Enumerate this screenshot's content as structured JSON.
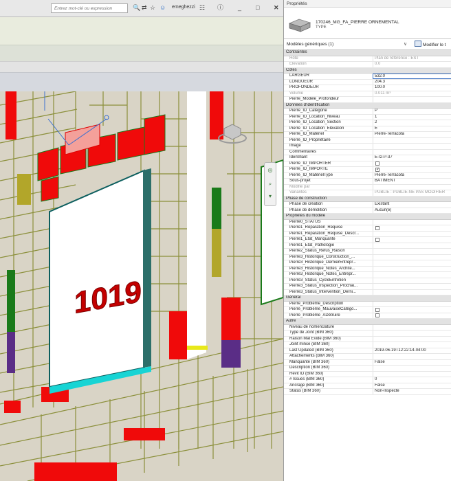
{
  "toolbar": {
    "search_placeholder": "Entrez mot-clé ou expression",
    "user": "emeghezzi",
    "icons": [
      "binoculars-icon",
      "star-icon",
      "user-icon",
      "cart-icon",
      "help-icon",
      "minimize-icon",
      "restore-icon",
      "close-icon"
    ]
  },
  "viewport": {
    "room_number": "1019",
    "colors": {
      "red": "#f00a0a",
      "stone": "#d9d4c6",
      "dark_green": "#1a7a1a",
      "purple": "#5a2d86",
      "yellow": "#e8e81a",
      "cyan": "#17d4d4",
      "olive": "#b2a62a",
      "teal": "#2c6f6a"
    }
  },
  "panel": {
    "title": "Propriétés",
    "type_name": "170246_MG_FA_PIERRE ORNEMENTAL",
    "type_sub": "TYPE",
    "instance_selector": "Modèles génériques (1)",
    "edit_type_label": "Modifier le t",
    "rows": [
      {
        "kind": "group",
        "label": "Contraintes"
      },
      {
        "label": "Hôte",
        "value": "Plan de référence : EST",
        "disabled": true
      },
      {
        "label": "Élévation",
        "value": "0.0",
        "disabled": true
      },
      {
        "kind": "group",
        "label": "Cotes"
      },
      {
        "label": "LARGEUR",
        "value": "532.0",
        "editing": true
      },
      {
        "label": "LONGUEUR",
        "value": "204.3"
      },
      {
        "label": "PROFONDEUR",
        "value": "100.0"
      },
      {
        "label": "Volume",
        "value": "0.011 m³",
        "disabled": true
      },
      {
        "label": "Pierre_Modele_Profondeur",
        "value": ""
      },
      {
        "kind": "group",
        "label": "Données d'identification"
      },
      {
        "label": "Pierre_ID_Catégorie",
        "value": "P"
      },
      {
        "label": "Pierre_ID_Location_Niveau",
        "value": "1"
      },
      {
        "label": "Pierre_ID_Location_Section",
        "value": "2"
      },
      {
        "label": "Pierre_ID_Location_Élévation",
        "value": "E"
      },
      {
        "label": "Pierre_ID_Matériel",
        "value": "Pierre-Terracota"
      },
      {
        "label": "Pierre_ID_Propriétaire",
        "value": ""
      },
      {
        "label": "Image",
        "value": ""
      },
      {
        "label": "Commentaires",
        "value": ""
      },
      {
        "label": "Identifiant",
        "value": "E-I2-P-37"
      },
      {
        "label": "Pierre_ID_IMPORTER",
        "check": true,
        "checked": false
      },
      {
        "label": "Pierre_ID_IMPORTÉ",
        "check": true,
        "checked": true
      },
      {
        "label": "Pierre_ID_MatérielType",
        "value": "Pierre-Terracota"
      },
      {
        "label": "Sous-projet",
        "value": "BÂTIMENT"
      },
      {
        "label": "Modifié par",
        "value": "",
        "disabled": true
      },
      {
        "label": "Variantes",
        "value": "PUBLIÉ : PUBLIÉ-NE PAS MODIFIER",
        "disabled": true
      },
      {
        "kind": "group",
        "label": "Phase de construction"
      },
      {
        "label": "Phase de création",
        "value": "Existant"
      },
      {
        "label": "Phase de démolition",
        "value": "Aucun(e)"
      },
      {
        "kind": "group",
        "label": "Propriétés du modèle"
      },
      {
        "label": "Pierre0_STATUS",
        "value": ""
      },
      {
        "label": "Pierre1_Réparation_Requise",
        "check": true,
        "checked": false
      },
      {
        "label": "Pierre1_Réparation_Requise_Descr...",
        "value": ""
      },
      {
        "label": "Pierre1_État_Manquante",
        "check": true,
        "checked": false
      },
      {
        "label": "Pierre1_État_Pathologie",
        "value": ""
      },
      {
        "label": "Pierre2_Status_Refus_Raison",
        "value": ""
      },
      {
        "label": "Pierre3_Historique_Construction_...",
        "value": ""
      },
      {
        "label": "Pierre3_Historique_DernierEntrepr...",
        "value": ""
      },
      {
        "label": "Pierre3_Historique_Notes_Archite...",
        "value": ""
      },
      {
        "label": "Pierre3_Historique_Notes_Entrepr...",
        "value": ""
      },
      {
        "label": "Pierre3_Status_CycleEntretien",
        "value": ""
      },
      {
        "label": "Pierre3_Status_Inspection_Prochai...",
        "value": ""
      },
      {
        "label": "Pierre3_Status_Intervention_Derni...",
        "value": ""
      },
      {
        "kind": "group",
        "label": "Général"
      },
      {
        "label": "Pierre_Problème_Description",
        "value": ""
      },
      {
        "label": "Pierre_Problème_MauvaiseCatégo...",
        "check": true,
        "checked": false
      },
      {
        "label": "Pierre_Problème_ÀDétruire",
        "check": true,
        "checked": false
      },
      {
        "kind": "group",
        "label": "Autre"
      },
      {
        "label": "Niveau de nomenclature",
        "value": ""
      },
      {
        "label": "Type de Joint (BIM 360)",
        "value": ""
      },
      {
        "label": "Raison Mal Évidé (BIM 360)",
        "value": ""
      },
      {
        "label": "Joint mince (BIM 360)",
        "value": ""
      },
      {
        "label": "Last Updated (BIM 360)",
        "value": "2019-06-19T12:22:14-04:00"
      },
      {
        "label": "Attachements (BIM 360)",
        "value": ""
      },
      {
        "label": "Manquante (BIM 360)",
        "value": "False"
      },
      {
        "label": "Description (BIM 360)",
        "value": ""
      },
      {
        "label": "Revit ID (BIM 360)",
        "value": ""
      },
      {
        "label": "# Issues (BIM 360)",
        "value": "0"
      },
      {
        "label": "Ancrage (BIM 360)",
        "value": "False"
      },
      {
        "label": "Status (BIM 360)",
        "value": "Non-Inspecté"
      }
    ]
  }
}
